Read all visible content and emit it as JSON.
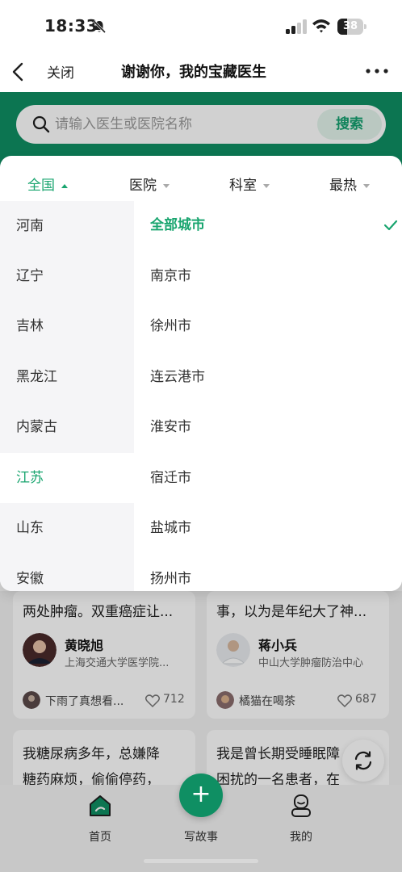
{
  "status_bar": {
    "time": "18:33",
    "battery": "38",
    "battery_level": 0.38
  },
  "nav": {
    "close_label": "关闭",
    "title": "谢谢你，我的宝藏医生"
  },
  "search": {
    "placeholder": "请输入医生或医院名称",
    "value": "",
    "button_label": "搜索"
  },
  "filter_tabs": [
    {
      "label": "全国",
      "active": true
    },
    {
      "label": "医院",
      "active": false
    },
    {
      "label": "科室",
      "active": false
    },
    {
      "label": "最热",
      "active": false
    }
  ],
  "provinces": [
    "河南",
    "辽宁",
    "吉林",
    "黑龙江",
    "内蒙古",
    "江苏",
    "山东",
    "安徽"
  ],
  "selected_province": "江苏",
  "cities": [
    "全部城市",
    "南京市",
    "徐州市",
    "连云港市",
    "淮安市",
    "宿迁市",
    "盐城市",
    "扬州市"
  ],
  "selected_city": "全部城市",
  "cards": [
    {
      "snippet": "两处肿瘤。双重癌症让...",
      "doctor_name": "黄晓旭",
      "hospital": "上海交通大学医学院...",
      "user": "下雨了真想看...",
      "likes": "712"
    },
    {
      "snippet": "事，以为是年纪大了神...",
      "doctor_name": "蒋小兵",
      "hospital": "中山大学肿瘤防治中心",
      "user": "橘猫在喝茶",
      "likes": "687"
    },
    {
      "snippet_lines": [
        "我糖尿病多年，总嫌降",
        "糖药麻烦，偷偷停药，"
      ]
    },
    {
      "snippet_lines": [
        "我是曾长期受睡眠障",
        "困扰的一名患者，在"
      ]
    }
  ],
  "tabbar": {
    "home": "首页",
    "write": "写故事",
    "mine": "我的"
  },
  "colors": {
    "brand_green": "#0f8f63",
    "accent_green": "#19a56f"
  }
}
